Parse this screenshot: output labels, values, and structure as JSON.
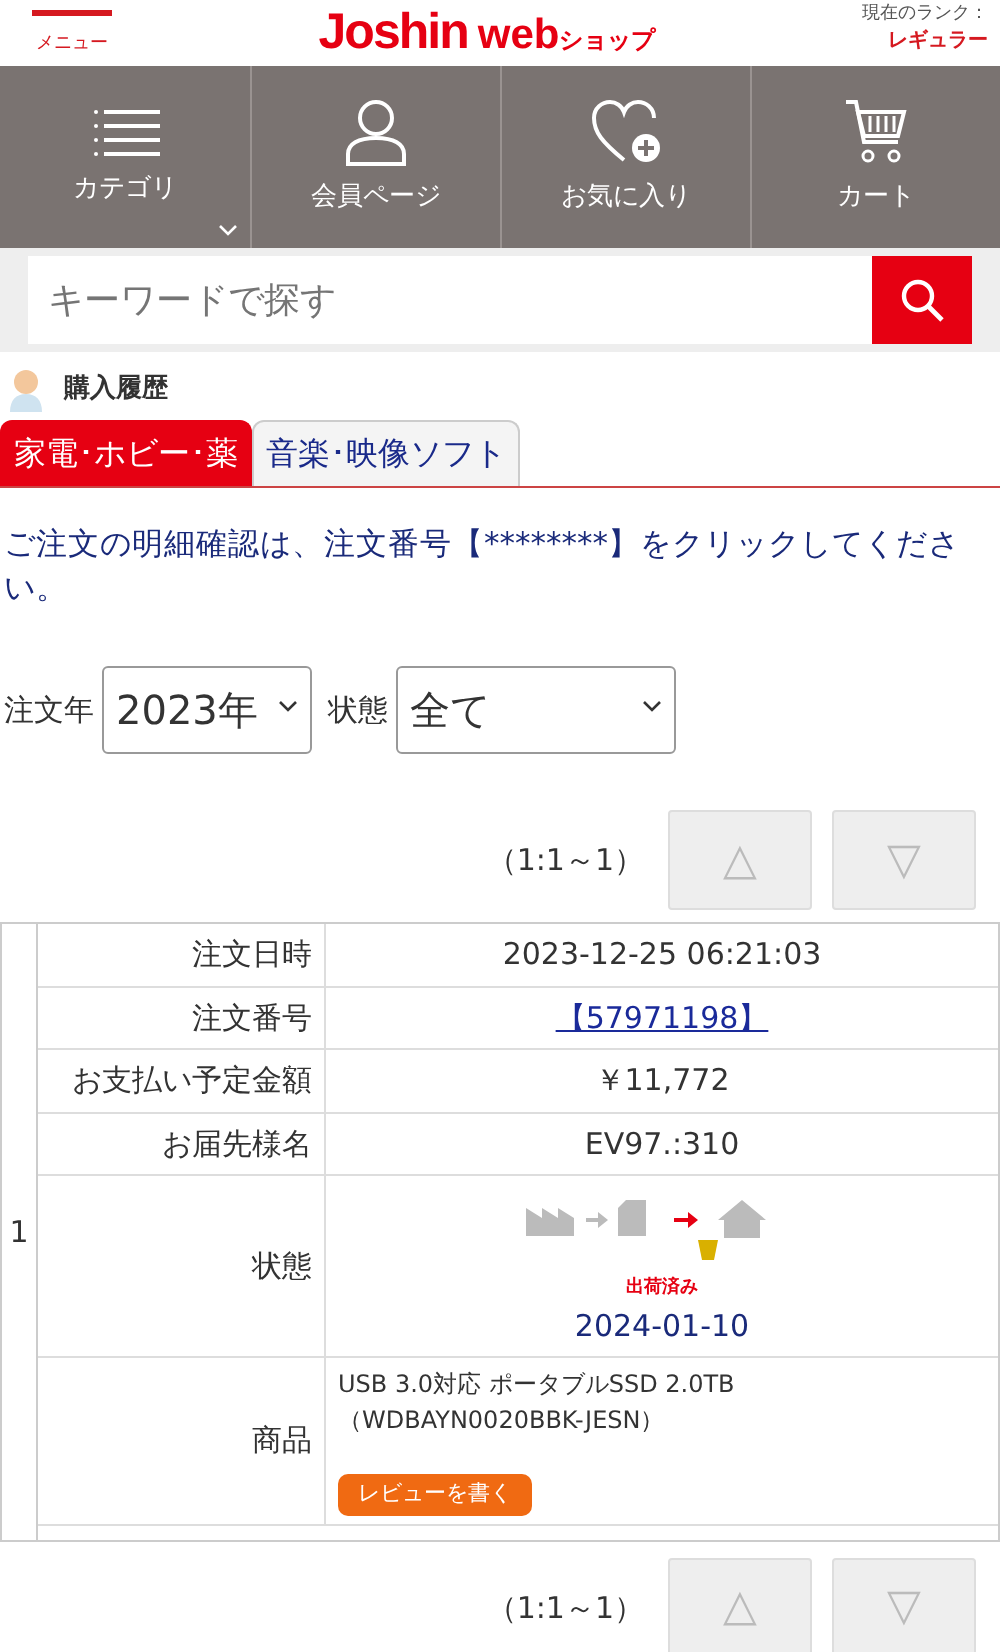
{
  "header": {
    "menu_label": "メニュー",
    "logo_main": "Joshin",
    "logo_web": "web",
    "logo_shop": "ショップ",
    "rank_label": "現在のランク：",
    "rank_value": "レギュラー"
  },
  "nav": [
    {
      "kind": "list",
      "label": "カテゴリ",
      "dropdown": true
    },
    {
      "kind": "person",
      "label": "会員ページ",
      "dropdown": false
    },
    {
      "kind": "heart",
      "label": "お気に入り",
      "dropdown": false
    },
    {
      "kind": "cart",
      "label": "カート",
      "dropdown": false
    }
  ],
  "search": {
    "placeholder": "キーワードで探す"
  },
  "section_title": "購入履歴",
  "tabs": [
    {
      "label": "家電･ホビー･薬",
      "selected": true
    },
    {
      "label": "音楽･映像ソフト",
      "selected": false
    }
  ],
  "notice": "ご注文の明細確認は、注文番号【********】をクリックしてください。",
  "filters": [
    {
      "label": "注文年",
      "value": "2023年"
    },
    {
      "label": "状態",
      "value": "全て"
    }
  ],
  "pager_top": {
    "range": "（1:1～1）",
    "prev": "△",
    "next": "▽"
  },
  "order": {
    "index": "1",
    "rows": [
      {
        "kind": "text",
        "label": "注文日時",
        "value": "2023-12-25 06:21:03"
      },
      {
        "kind": "link",
        "label": "注文番号",
        "value": "【57971198】"
      },
      {
        "kind": "text",
        "label": "お支払い予定金額",
        "value": "￥11,772"
      },
      {
        "kind": "text",
        "label": "お届先様名",
        "value": "EV97.:310"
      },
      {
        "kind": "status",
        "label": "状態",
        "status_text": "出荷済み",
        "value": "2024-01-10"
      },
      {
        "kind": "product",
        "label": "商品",
        "value": "USB 3.0対応 ポータブルSSD 2.0TB （WDBAYN0020BBK-JESN）",
        "button": "レビューを書く"
      }
    ]
  },
  "pager_bottom": {
    "range": "（1:1～1）",
    "prev": "△",
    "next": "▽"
  }
}
